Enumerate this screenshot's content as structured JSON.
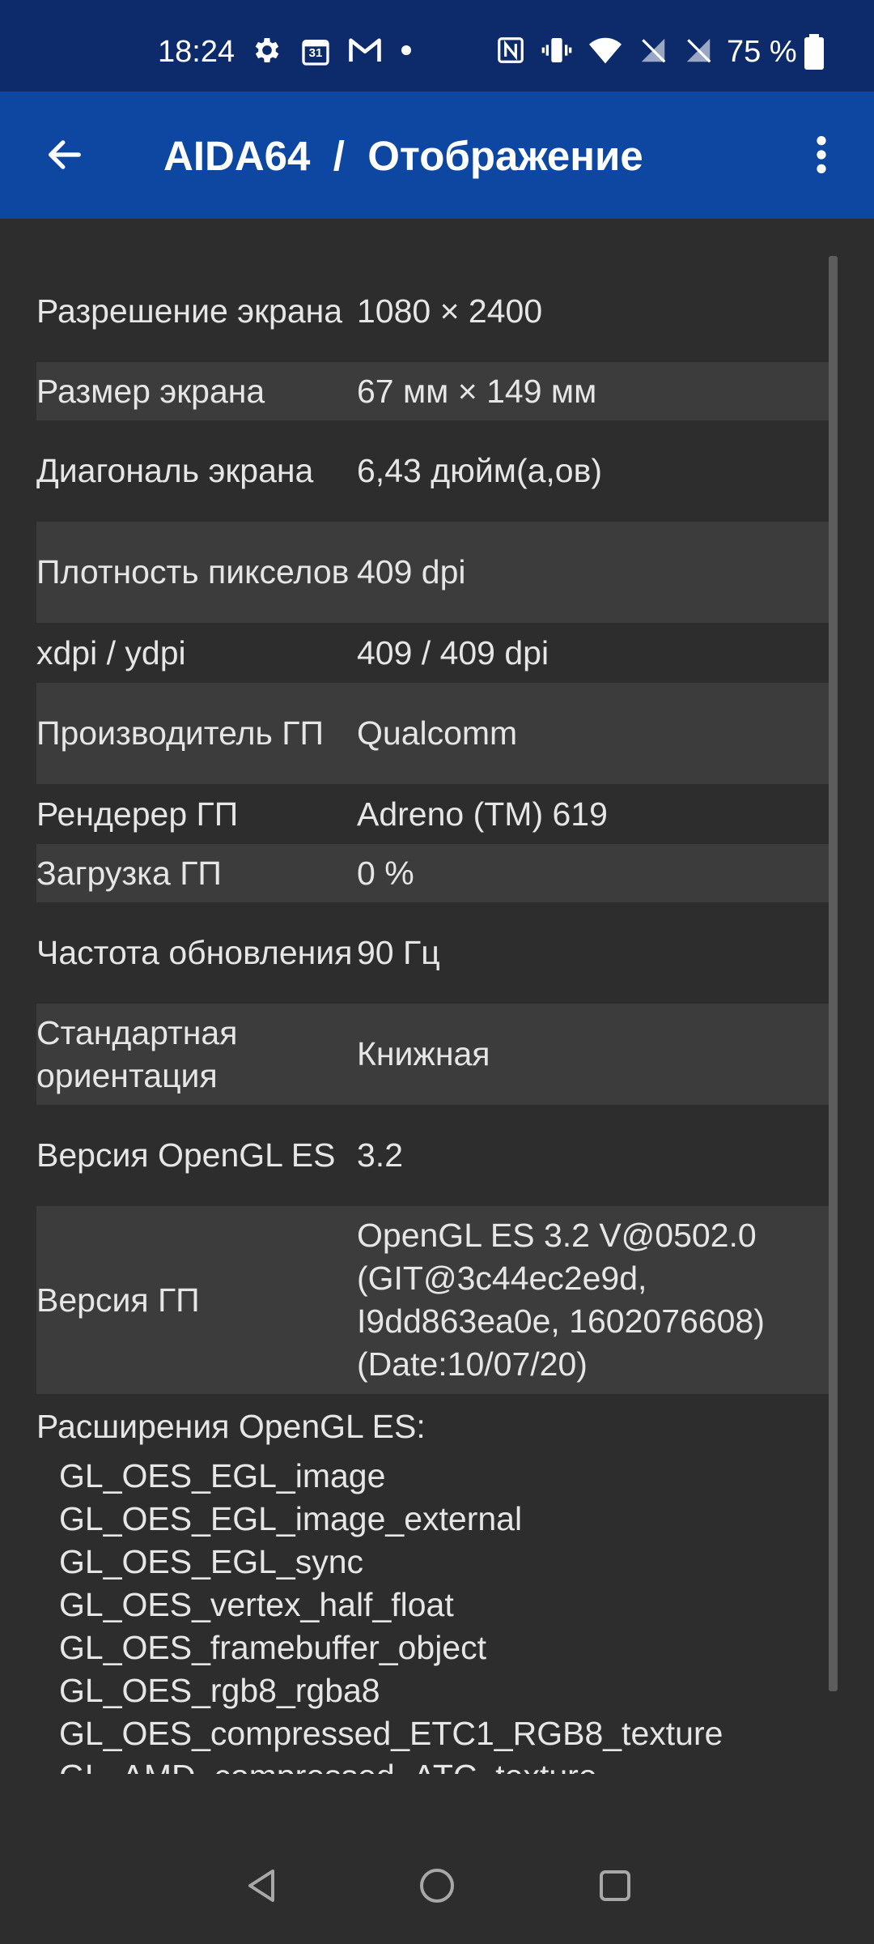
{
  "status_bar": {
    "time": "18:24",
    "calendar_day": "31",
    "battery_percent": "75 %"
  },
  "app_bar": {
    "title": "AIDA64  /  Отображение"
  },
  "rows": [
    {
      "label": "Разрешение экрана",
      "value": "1080 × 2400"
    },
    {
      "label": "Размер экрана",
      "value": "67 мм × 149 мм"
    },
    {
      "label": "Диагональ экрана",
      "value": "6,43 дюйм(а,ов)"
    },
    {
      "label": "Плотность пикселов",
      "value": "409 dpi"
    },
    {
      "label": "xdpi / ydpi",
      "value": "409 / 409 dpi"
    },
    {
      "label": "Производитель ГП",
      "value": "Qualcomm"
    },
    {
      "label": "Рендерер ГП",
      "value": "Adreno (TM) 619"
    },
    {
      "label": "Загрузка ГП",
      "value": "0 %"
    },
    {
      "label": "Частота обновления",
      "value": "90 Гц"
    },
    {
      "label": "Стандартная ориентация",
      "value": "Книжная"
    },
    {
      "label": "Версия OpenGL ES",
      "value": "3.2"
    },
    {
      "label": "Версия ГП",
      "value": "OpenGL ES 3.2 V@0502.0 (GIT@3c44ec2e9d, I9dd863ea0e, 1602076608) (Date:10/07/20)"
    }
  ],
  "extensions": {
    "title": "Расширения OpenGL ES:",
    "items": [
      "GL_OES_EGL_image",
      "GL_OES_EGL_image_external",
      "GL_OES_EGL_sync",
      "GL_OES_vertex_half_float",
      "GL_OES_framebuffer_object",
      "GL_OES_rgb8_rgba8",
      "GL_OES_compressed_ETC1_RGB8_texture",
      "GL_AMD_compressed_ATC_texture"
    ]
  },
  "icons": {
    "back": "arrow-back-icon",
    "menu": "more-vert-icon",
    "settings": "gear-icon",
    "calendar": "calendar-icon",
    "gmail": "gmail-icon",
    "notification_dot": "dot-icon",
    "nfc": "nfc-icon",
    "vibrate": "vibrate-icon",
    "wifi": "wifi-icon",
    "no_signal_1": "no-signal-icon",
    "no_signal_2": "no-signal-icon",
    "battery": "battery-icon",
    "nav_back": "triangle-back-icon",
    "nav_home": "circle-home-icon",
    "nav_recents": "square-recents-icon"
  },
  "colors": {
    "status_bar": "#0d2b6b",
    "app_bar": "#0d47a1",
    "background": "#2d2d2d",
    "row_alt": "#3c3c3c",
    "text": "#e6e6e6"
  }
}
